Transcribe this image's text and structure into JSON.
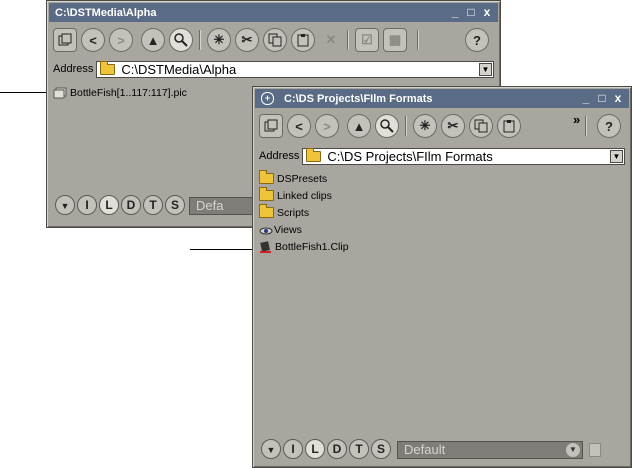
{
  "window_back": {
    "title": "C:\\DSTMedia\\Alpha",
    "address_label": "Address",
    "address_value": "C:\\DSTMedia\\Alpha",
    "items": [
      {
        "label": "BottleFish[1..117:117].pic",
        "icon": "image-sequence-icon"
      }
    ],
    "view_modes": [
      "I",
      "L",
      "D",
      "T",
      "S"
    ],
    "active_view": "L",
    "preset_value": "Defa"
  },
  "window_front": {
    "title": "C:\\DS Projects\\FIlm Formats",
    "address_label": "Address",
    "address_value": "C:\\DS Projects\\FIlm Formats",
    "overflow_glyph": "»",
    "items": [
      {
        "label": "DSPresets",
        "icon": "folder-icon"
      },
      {
        "label": "Linked clips",
        "icon": "folder-icon"
      },
      {
        "label": "Scripts",
        "icon": "folder-icon"
      },
      {
        "label": "Views",
        "icon": "views-icon"
      },
      {
        "label": "BottleFish1.Clip",
        "icon": "clip-icon"
      }
    ],
    "view_modes": [
      "I",
      "L",
      "D",
      "T",
      "S"
    ],
    "active_view": "L",
    "preset_value": "Default"
  },
  "toolbar_glyphs": {
    "up_label": "▲",
    "help_label": "?",
    "back_label": "<",
    "forward_label": ">",
    "close_label": "x",
    "minimize_label": "_",
    "maximize_label": "□",
    "dropdown_label": "▼"
  },
  "colors": {
    "titlebar": "#5a6b86",
    "window_bg": "#a9a6a0",
    "folder": "#f0c43a"
  }
}
